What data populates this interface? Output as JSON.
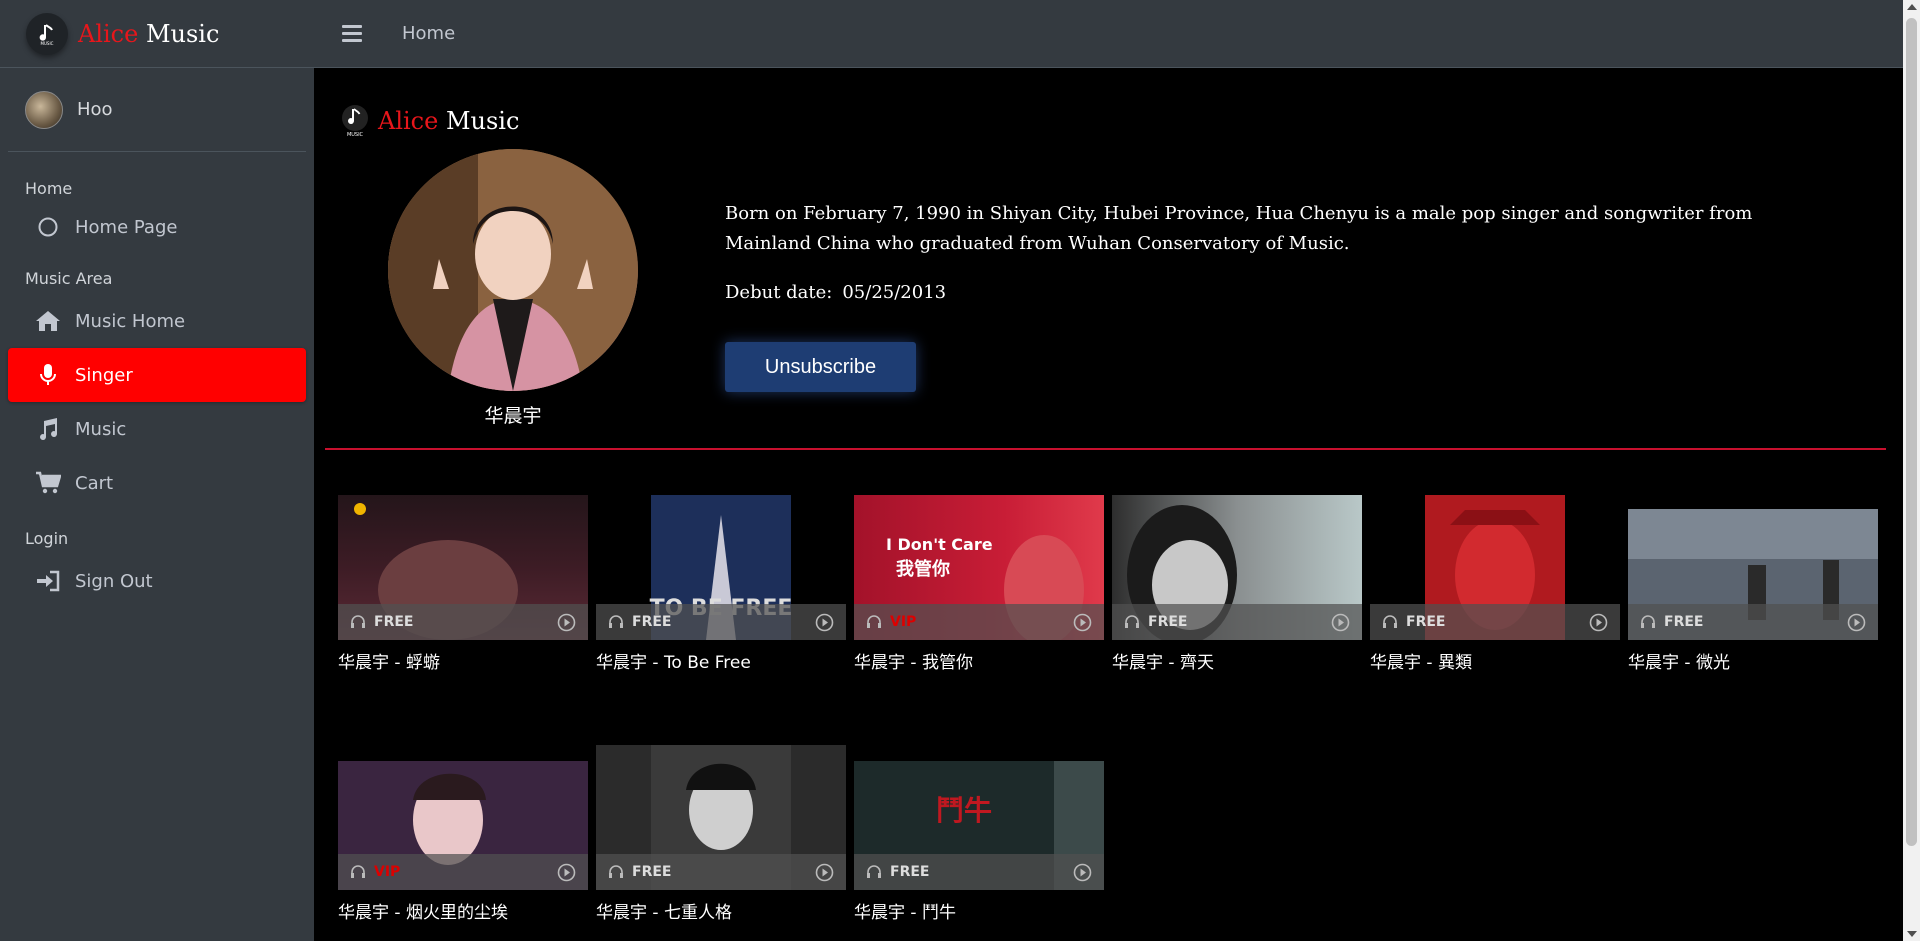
{
  "brand": {
    "alice": "Alice",
    "music": " Music",
    "logo_caption": "MUSIC"
  },
  "user": {
    "name": "Hoo"
  },
  "sidebar": {
    "sections": [
      {
        "header": "Home",
        "items": [
          {
            "label": "Home Page",
            "icon": "circle-icon"
          }
        ]
      },
      {
        "header": "Music Area",
        "items": [
          {
            "label": "Music Home",
            "icon": "house-icon"
          },
          {
            "label": "Singer",
            "icon": "microphone-icon",
            "active": true
          },
          {
            "label": "Music",
            "icon": "music-note-icon"
          },
          {
            "label": "Cart",
            "icon": "cart-icon"
          }
        ]
      },
      {
        "header": "Login",
        "items": [
          {
            "label": "Sign Out",
            "icon": "sign-in-icon"
          }
        ]
      }
    ],
    "active_color": "#ff0000"
  },
  "topbar": {
    "title": "Home"
  },
  "singer": {
    "name": "华晨宇",
    "bio": "Born on February 7, 1990 in Shiyan City, Hubei Province, Hua Chenyu is a male pop singer and songwriter from Mainland China who graduated from Wuhan Conservatory of Music.",
    "debut_label": "Debut date:",
    "debut_date": "05/25/2013",
    "unsubscribe_label": "Unsubscribe"
  },
  "videos": [
    {
      "title": "华晨宇 - 蜉蝣",
      "tag": "FREE"
    },
    {
      "title": "华晨宇 - To Be Free",
      "tag": "FREE"
    },
    {
      "title": "华晨宇 - 我管你",
      "tag": "VIP"
    },
    {
      "title": "华晨宇 - 齊天",
      "tag": "FREE"
    },
    {
      "title": "华晨宇 - 異類",
      "tag": "FREE"
    },
    {
      "title": "华晨宇 - 微光",
      "tag": "FREE"
    },
    {
      "title": "华晨宇 - 烟火里的尘埃",
      "tag": "VIP"
    },
    {
      "title": "华晨宇 - 七重人格",
      "tag": "FREE"
    },
    {
      "title": "华晨宇 - 鬥牛",
      "tag": "FREE"
    }
  ],
  "colors": {
    "sidebar_bg": "#343a40",
    "accent_red": "#e8161b",
    "divider": "#c8102e",
    "button_bg": "#1e3d73"
  }
}
